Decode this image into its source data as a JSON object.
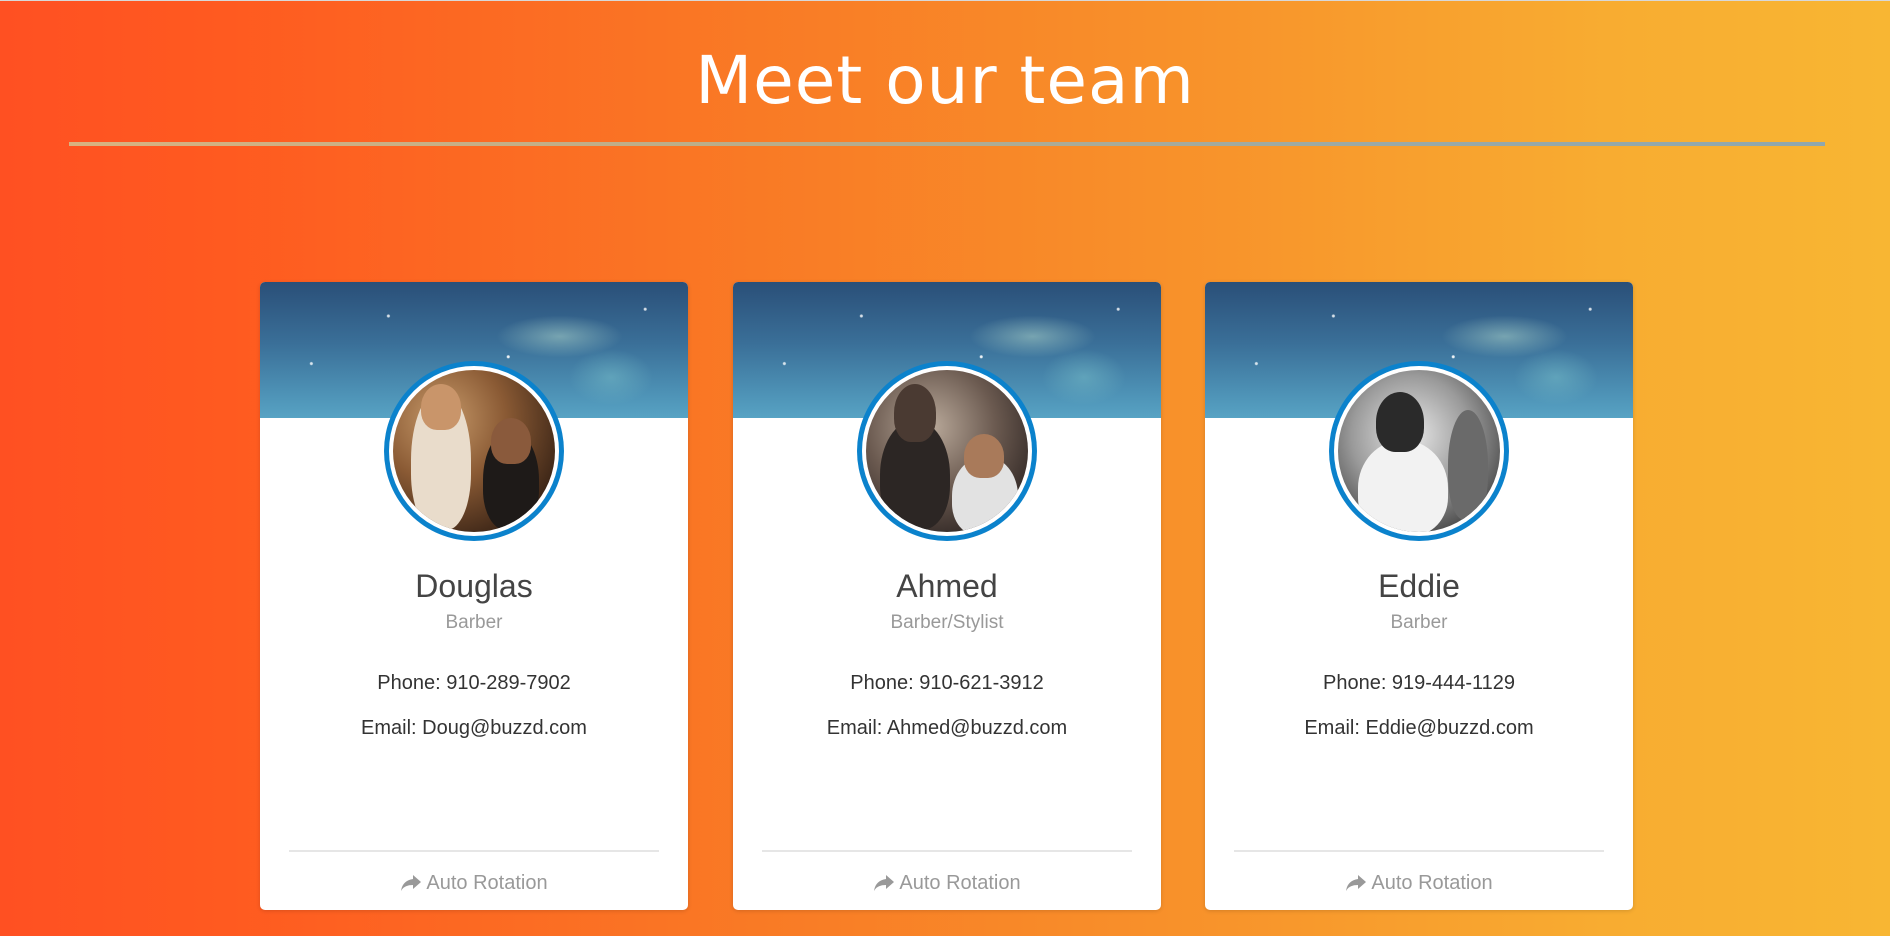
{
  "page": {
    "title": "Meet our team"
  },
  "colors": {
    "gradient_start": "#ff5022",
    "gradient_end": "#f8b633",
    "avatar_ring": "#0b82cc",
    "name_text": "#444444",
    "muted_text": "#999999"
  },
  "team": [
    {
      "name": "Douglas",
      "role": "Barber",
      "phone": "Phone: 910-289-7902",
      "email": "Email: Doug@buzzd.com",
      "footer_label": "Auto Rotation",
      "footer_icon": "share-icon"
    },
    {
      "name": "Ahmed",
      "role": "Barber/Stylist",
      "phone": "Phone: 910-621-3912",
      "email": "Email: Ahmed@buzzd.com",
      "footer_label": "Auto Rotation",
      "footer_icon": "share-icon"
    },
    {
      "name": "Eddie",
      "role": "Barber",
      "phone": "Phone: 919-444-1129",
      "email": "Email: Eddie@buzzd.com",
      "footer_label": "Auto Rotation",
      "footer_icon": "share-icon"
    }
  ]
}
